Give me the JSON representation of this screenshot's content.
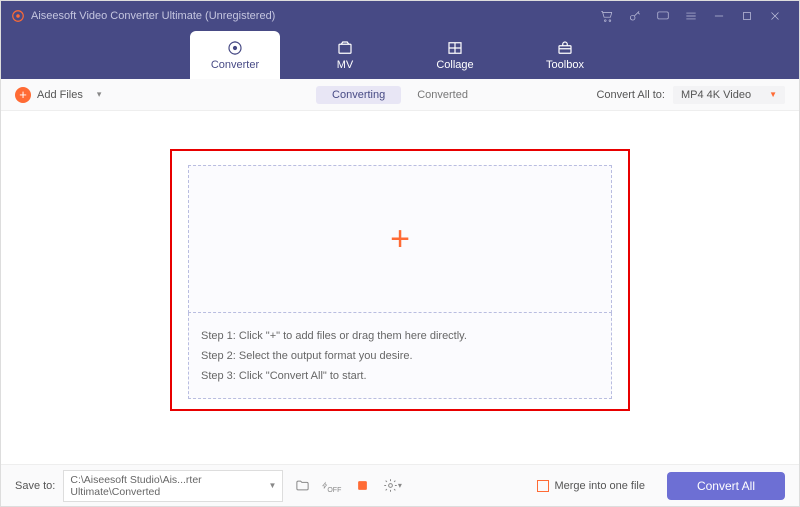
{
  "title": "Aiseesoft Video Converter Ultimate (Unregistered)",
  "tabs": {
    "converter": "Converter",
    "mv": "MV",
    "collage": "Collage",
    "toolbox": "Toolbox"
  },
  "toolbar": {
    "add_files": "Add Files",
    "converting": "Converting",
    "converted": "Converted",
    "convert_all_to": "Convert All to:",
    "format": "MP4 4K Video"
  },
  "steps": {
    "s1": "Step 1: Click \"+\" to add files or drag them here directly.",
    "s2": "Step 2: Select the output format you desire.",
    "s3": "Step 3: Click \"Convert All\" to start."
  },
  "footer": {
    "save_to": "Save to:",
    "path": "C:\\Aiseesoft Studio\\Ais...rter Ultimate\\Converted",
    "merge": "Merge into one file",
    "convert_all": "Convert All"
  }
}
